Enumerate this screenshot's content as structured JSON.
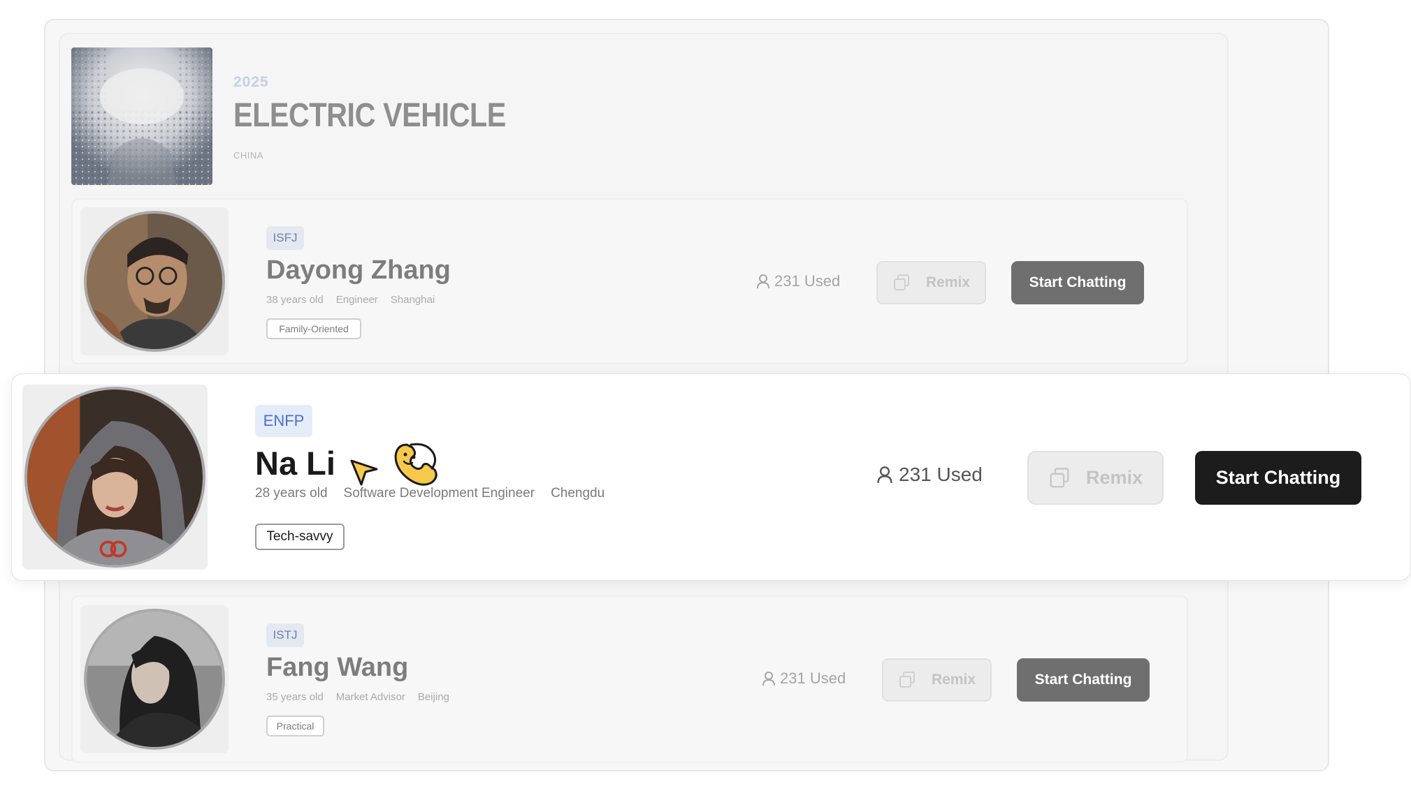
{
  "feature": {
    "year": "2025",
    "title": "ELECTRIC VEHICLE",
    "country": "CHINA"
  },
  "personas": [
    {
      "mbti": "ISFJ",
      "name": "Dayong Zhang",
      "age": "38 years old",
      "job": "Engineer",
      "city": "Shanghai",
      "tag": "Family-Oriented",
      "used": "231 Used",
      "remix_label": "Remix",
      "start_label": "Start Chatting"
    },
    {
      "mbti": "ENFP",
      "name": "Na Li",
      "age": "28 years old",
      "job": "Software Development Engineer",
      "city": "Chengdu",
      "tag": "Tech-savvy",
      "used": "231 Used",
      "remix_label": "Remix",
      "start_label": "Start Chatting"
    },
    {
      "mbti": "ISTJ",
      "name": "Fang Wang",
      "age": "35 years old",
      "job": "Market Advisor",
      "city": "Beijing",
      "tag": "Practical",
      "used": "231 Used",
      "remix_label": "Remix",
      "start_label": "Start Chatting"
    }
  ],
  "icons": {
    "used": "user-icon",
    "remix": "copy-icon",
    "cursor": "cursor-pointer-icon",
    "sticker": "phone-mascot-icon"
  },
  "colors": {
    "accent_blue": "#4a6fd1",
    "start_button_active": "#1c1c1c",
    "start_button_dim": "#6f6f6f",
    "sticker_yellow": "#f7c94b"
  }
}
